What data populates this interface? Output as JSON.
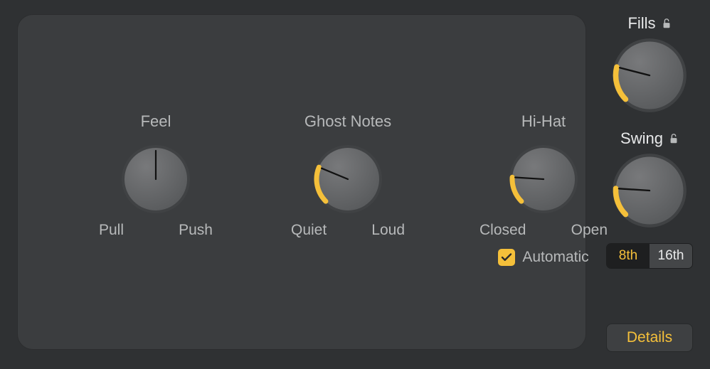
{
  "panel": {
    "feel": {
      "title": "Feel",
      "left": "Pull",
      "right": "Push",
      "value": 0.5,
      "arc_start": null,
      "arc_end": null
    },
    "ghost": {
      "title": "Ghost Notes",
      "left": "Quiet",
      "right": "Loud",
      "value": 0.25
    },
    "hihat": {
      "title": "Hi-Hat",
      "left": "Closed",
      "right": "Open",
      "value": 0.18,
      "automatic_label": "Automatic",
      "automatic_checked": true
    }
  },
  "side": {
    "fills": {
      "title": "Fills",
      "value": 0.22
    },
    "swing": {
      "title": "Swing",
      "value": 0.18,
      "options": [
        "8th",
        "16th"
      ],
      "selected": "8th"
    },
    "details_label": "Details",
    "lock_icon_name": "lock-open-icon"
  },
  "colors": {
    "accent": "#f5c03a",
    "knob_face": "#6a6b6d",
    "knob_dark": "#47494b",
    "panel": "#3b3d3f",
    "bg": "#2f3133"
  }
}
